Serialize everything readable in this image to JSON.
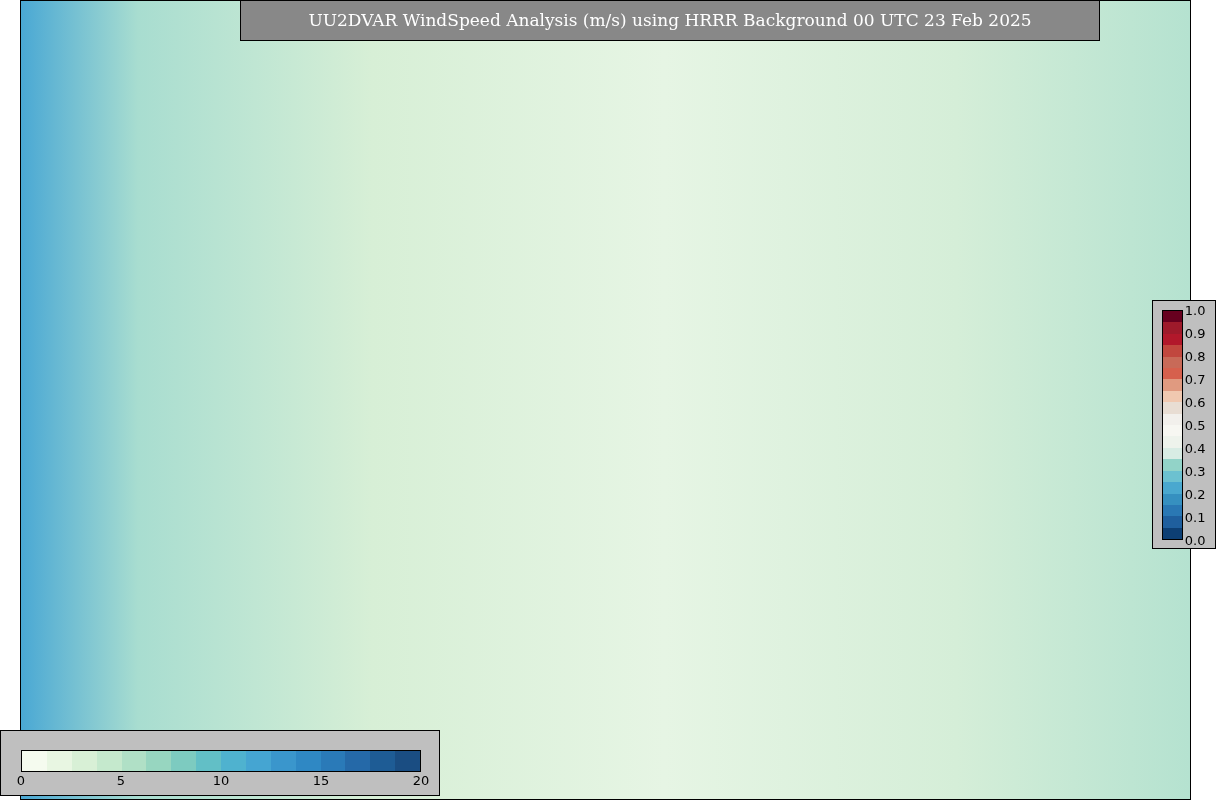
{
  "title": "UU2DVAR WindSpeed Analysis (m/s) using HRRR Background 00 UTC 23 Feb 2025",
  "ratio_colorbar": {
    "ticks": [
      "1.0",
      "0.9",
      "0.8",
      "0.7",
      "0.6",
      "0.5",
      "0.4",
      "0.3",
      "0.2",
      "0.1",
      "0.0"
    ]
  },
  "speed_colorbar": {
    "ticks": [
      "0",
      "5",
      "10",
      "15",
      "20"
    ]
  }
}
